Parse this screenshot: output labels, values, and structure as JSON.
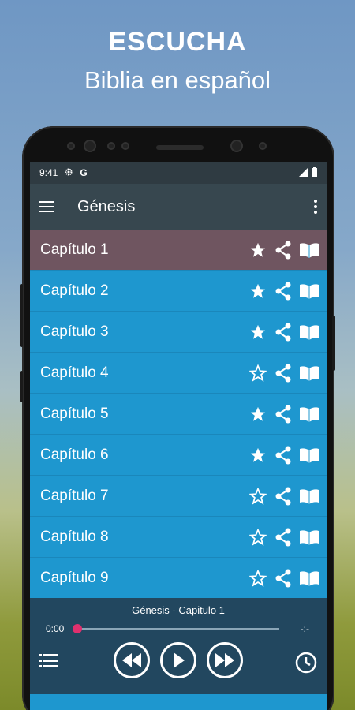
{
  "promo": {
    "title": "ESCUCHA",
    "subtitle": "Biblia en español"
  },
  "statusbar": {
    "time": "9:41",
    "icons": [
      "gear-icon",
      "google-icon",
      "signal-icon",
      "battery-icon"
    ]
  },
  "appbar": {
    "title": "Génesis"
  },
  "chapters": [
    {
      "label": "Capítulo 1",
      "favorite": true,
      "active": true
    },
    {
      "label": "Capítulo 2",
      "favorite": true
    },
    {
      "label": "Capítulo 3",
      "favorite": true
    },
    {
      "label": "Capítulo 4",
      "favorite": false
    },
    {
      "label": "Capítulo 5",
      "favorite": true
    },
    {
      "label": "Capítulo 6",
      "favorite": true
    },
    {
      "label": "Capítulo 7",
      "favorite": false
    },
    {
      "label": "Capítulo 8",
      "favorite": false
    },
    {
      "label": "Capítulo 9",
      "favorite": false
    }
  ],
  "player": {
    "track": "Génesis - Capitulo 1",
    "elapsed": "0:00",
    "remaining": "-:-",
    "progress": 0
  },
  "colors": {
    "list_bg": "#1e97cf",
    "active_row": "#6f5560",
    "appbar": "#37474f",
    "player": "#22475f",
    "accent": "#e0306e"
  }
}
